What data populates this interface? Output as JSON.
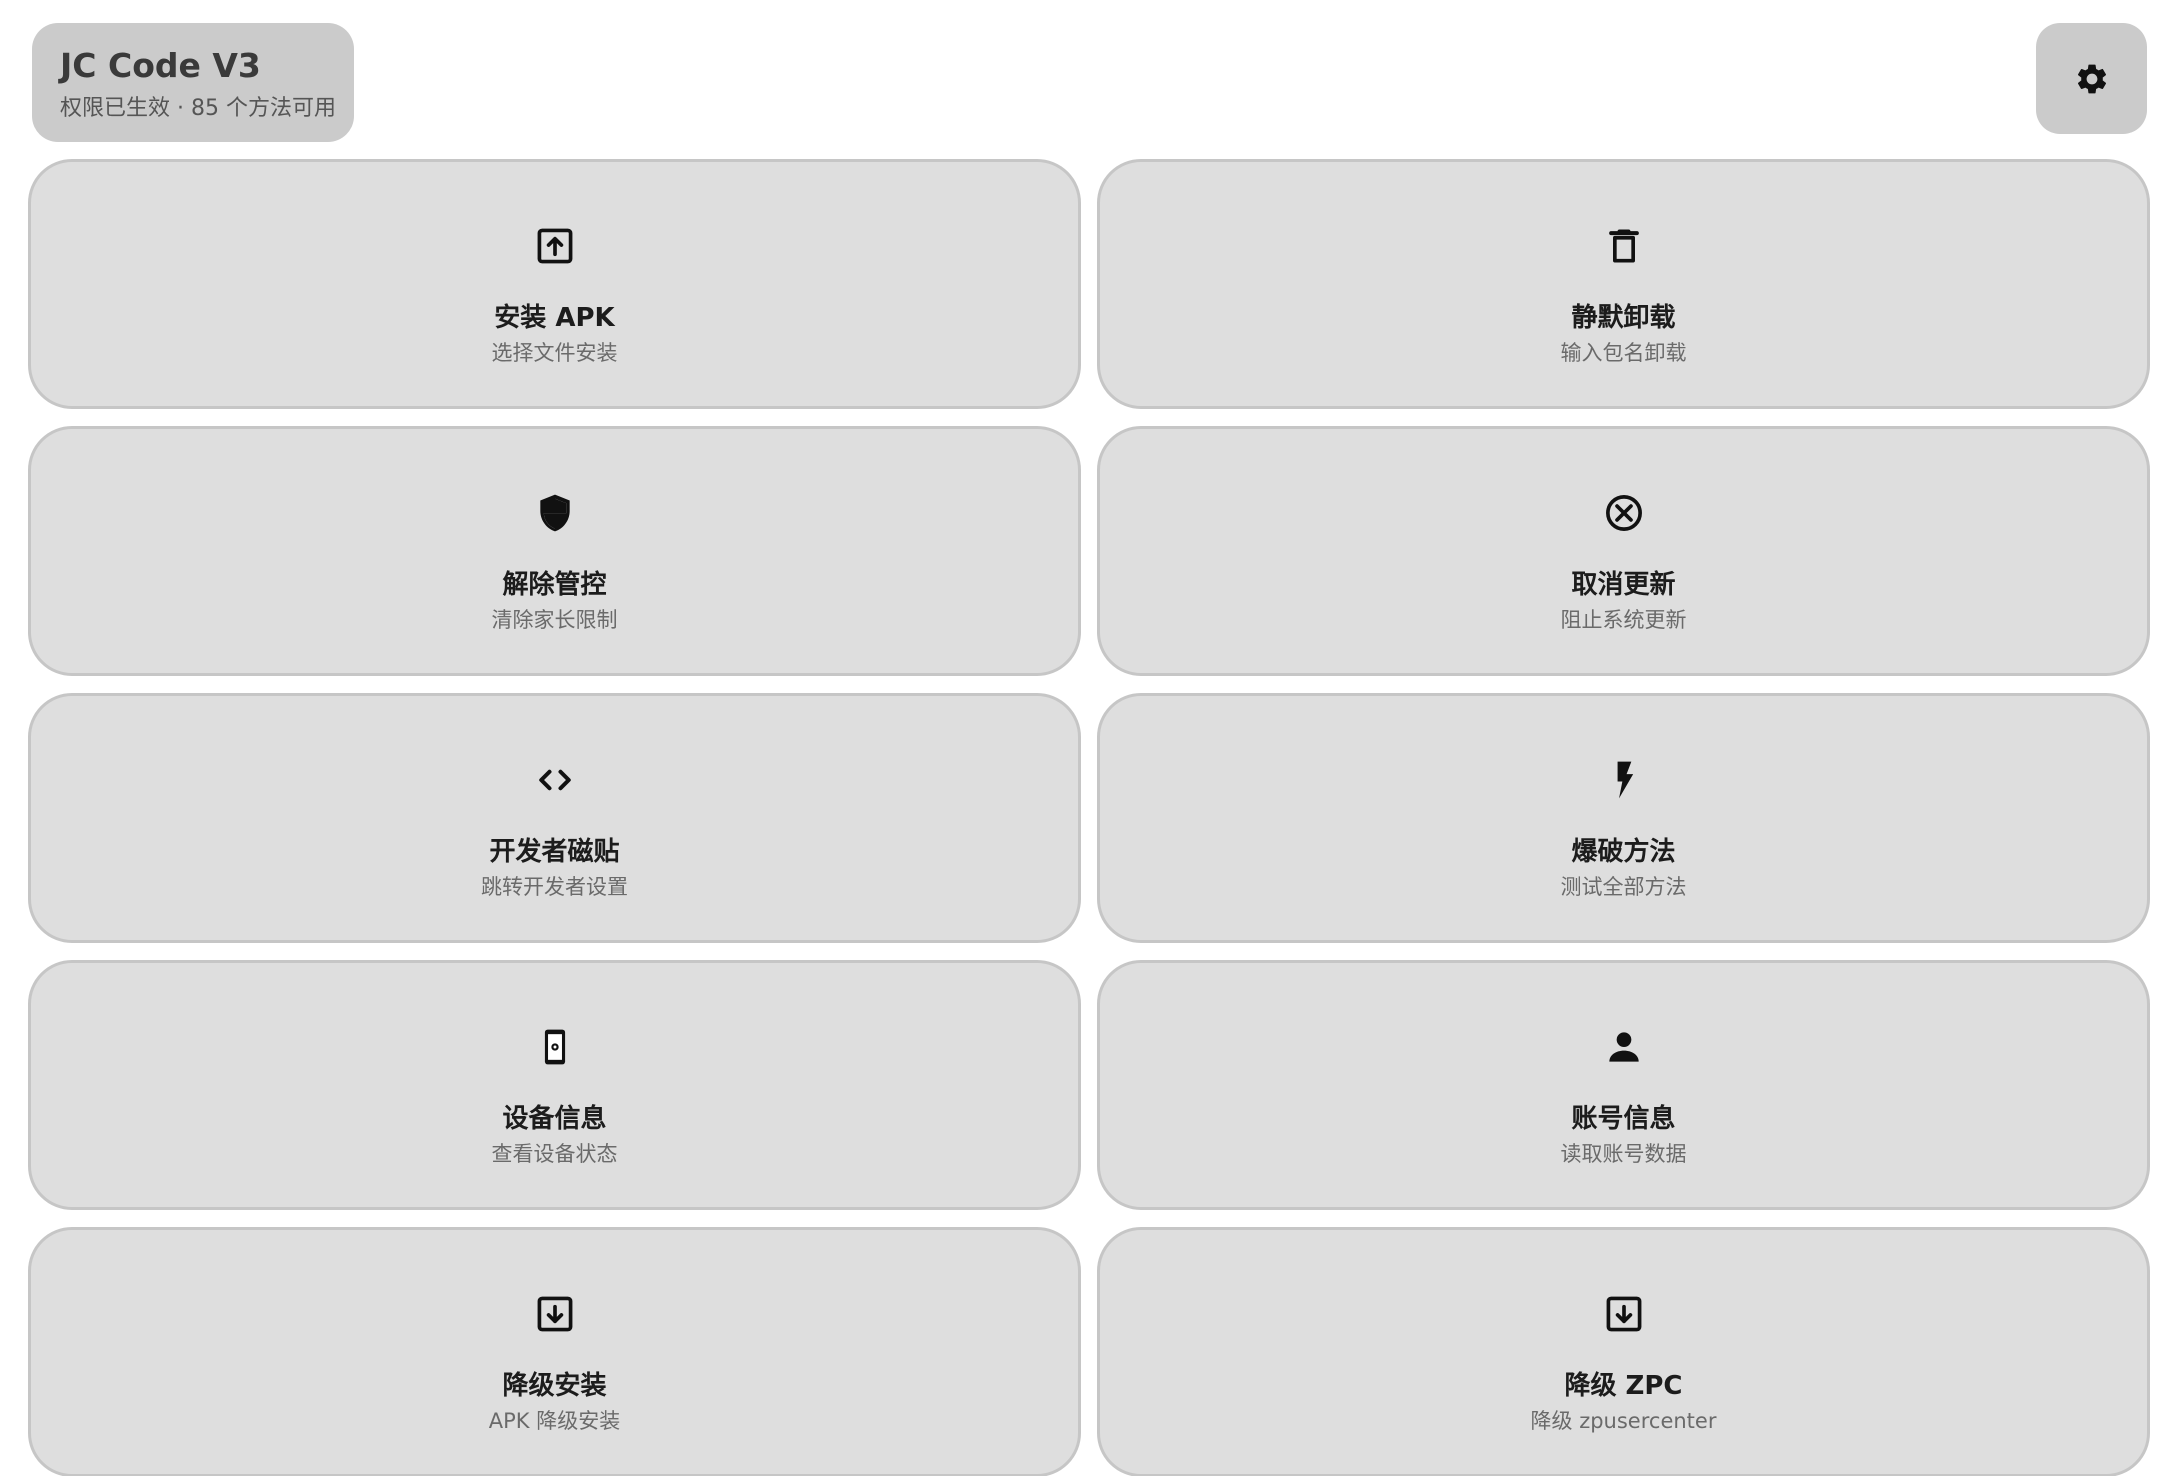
{
  "header": {
    "title": "JC Code V3",
    "subtitle": "权限已生效 · 85 个方法可用",
    "settings_icon": "gear-icon"
  },
  "actions": [
    {
      "title": "安装 APK",
      "subtitle": "选择文件安装",
      "icon": "upload-box-icon"
    },
    {
      "title": "静默卸载",
      "subtitle": "输入包名卸载",
      "icon": "trash-icon"
    },
    {
      "title": "解除管控",
      "subtitle": "清除家长限制",
      "icon": "shield-icon"
    },
    {
      "title": "取消更新",
      "subtitle": "阻止系统更新",
      "icon": "cancel-circle-icon"
    },
    {
      "title": "开发者磁贴",
      "subtitle": "跳转开发者设置",
      "icon": "code-icon"
    },
    {
      "title": "爆破方法",
      "subtitle": "测试全部方法",
      "icon": "lightning-icon"
    },
    {
      "title": "设备信息",
      "subtitle": "查看设备状态",
      "icon": "phone-icon"
    },
    {
      "title": "账号信息",
      "subtitle": "读取账号数据",
      "icon": "person-icon"
    },
    {
      "title": "降级安装",
      "subtitle": "APK 降级安装",
      "icon": "download-box-icon"
    },
    {
      "title": "降级 ZPC",
      "subtitle": "降级 zpusercenter",
      "icon": "download-box-icon"
    }
  ],
  "colors": {
    "card_bg": "#dedede",
    "card_border": "#c6c6c6",
    "chip_bg": "#cbcbcb",
    "text_primary": "#1c1c1c",
    "text_secondary": "#6a6a6a"
  }
}
